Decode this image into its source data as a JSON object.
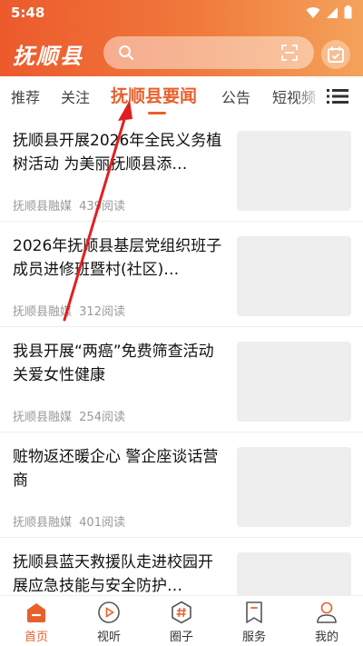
{
  "status": {
    "time": "5:48"
  },
  "header": {
    "logo": "抚顺县",
    "search_placeholder": ""
  },
  "tabs": [
    {
      "label": "推荐"
    },
    {
      "label": "关注"
    },
    {
      "label": "抚顺县要闻"
    },
    {
      "label": "公告"
    },
    {
      "label": "短视频"
    }
  ],
  "news": [
    {
      "title": "抚顺县开展2026年全民义务植树活动 为美丽抚顺县添…",
      "source": "抚顺县融媒",
      "reads": "439阅读"
    },
    {
      "title": "2026年抚顺县基层党组织班子成员进修班暨村(社区)…",
      "source": "抚顺县融媒",
      "reads": "312阅读"
    },
    {
      "title": "我县开展“两癌”免费筛查活动 关爱女性健康",
      "source": "抚顺县融媒",
      "reads": "254阅读"
    },
    {
      "title": "赃物返还暖企心 警企座谈话营商",
      "source": "抚顺县融媒",
      "reads": "401阅读"
    },
    {
      "title": "抚顺县蓝天救援队走进校园开展应急技能与安全防护…",
      "source": "",
      "reads": ""
    }
  ],
  "bottom_nav": [
    {
      "label": "首页",
      "icon": "home-icon"
    },
    {
      "label": "视听",
      "icon": "play-icon"
    },
    {
      "label": "圈子",
      "icon": "hashtag-icon"
    },
    {
      "label": "服务",
      "icon": "bookmark-icon"
    },
    {
      "label": "我的",
      "icon": "user-icon"
    }
  ],
  "colors": {
    "accent": "#e8602c",
    "header_start": "#ec5a2c",
    "header_end": "#f4a25a",
    "annotation": "#e02020"
  }
}
